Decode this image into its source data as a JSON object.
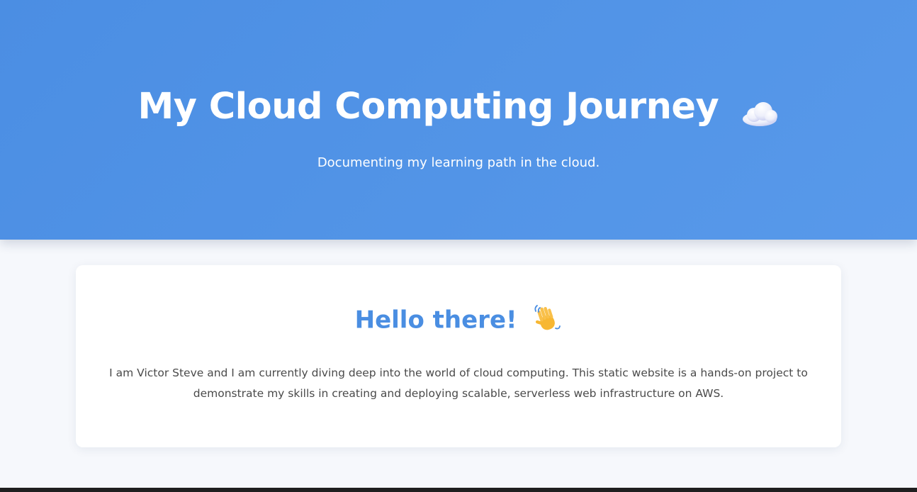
{
  "header": {
    "title": "My Cloud Computing Journey",
    "title_icon": "cloud-icon",
    "subtitle": "Documenting my learning path in the cloud.",
    "background_color": "#4f91e6"
  },
  "intro_card": {
    "heading": "Hello there!",
    "heading_icon": "waving-hand-icon",
    "heading_color": "#4a8ee2",
    "body": "I am Victor Steve and I am currently diving deep into the world of cloud computing. This static website is a hands-on project to demonstrate my skills in creating and deploying scalable, serverless web infrastructure on AWS."
  },
  "colors": {
    "page_background": "#f6f8fc",
    "card_background": "#ffffff",
    "body_text": "#4a4a4a"
  }
}
